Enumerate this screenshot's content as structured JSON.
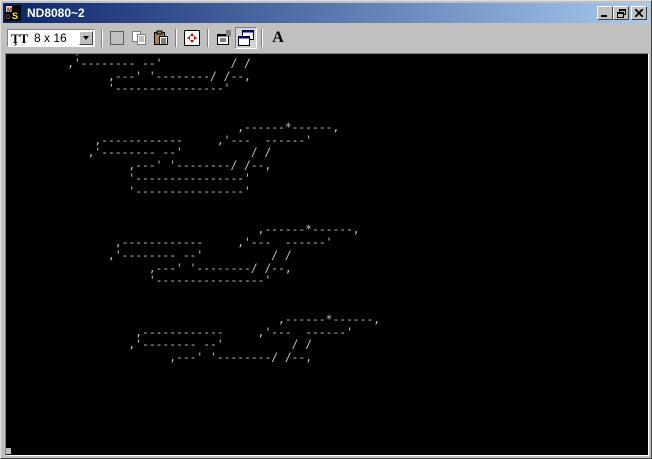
{
  "window": {
    "title": "ND8080~2",
    "app_icon": "ms-dos-icon"
  },
  "title_buttons": [
    "minimize-icon",
    "restore-icon",
    "close-icon"
  ],
  "toolbar": {
    "font_size_select": {
      "value": "8 x 16",
      "icon": "truetype-font-icon"
    },
    "buttons": [
      {
        "name": "mark-button",
        "icon": "mark-icon"
      },
      {
        "name": "copy-button",
        "icon": "copy-icon"
      },
      {
        "name": "paste-button",
        "icon": "paste-icon"
      },
      {
        "name": "full-screen-button",
        "icon": "full-screen-icon"
      },
      {
        "name": "properties-button",
        "icon": "properties-icon"
      },
      {
        "name": "background-button",
        "icon": "background-icon",
        "pressed": true
      },
      {
        "name": "font-button",
        "icon": "font-icon",
        "label": "A"
      }
    ]
  },
  "terminal": {
    "lines": [
      "          ,------------     '---  ------'",
      "         ,'-------- --'          / /",
      "               ,---' '--------/ /--,",
      "               '----------------'",
      "",
      "",
      "                                  ,------*------,",
      "             ,------------     ,'---  ------'",
      "            ,'-------- --'          / /",
      "                  ,---' '--------/ /--,",
      "                  '----------------'",
      "                  '----------------'",
      "",
      "",
      "                                     ,------*------,",
      "                ,------------     ,'---  ------'",
      "               ,'-------- --'          / /",
      "                     ,---' '--------/ /--,",
      "                     '----------------'",
      "",
      "",
      "                                        ,------*------,",
      "                   ,------------     ,'---  ------'",
      "                  ,'-------- --'          / /",
      "                        ,---' '--------/ /--,"
    ]
  },
  "colors": {
    "titlebar_start": "#0a246a",
    "titlebar_end": "#a6caf0",
    "terminal_bg": "#000000",
    "terminal_fg": "#c0c0c0",
    "chrome": "#c0c0c0"
  }
}
